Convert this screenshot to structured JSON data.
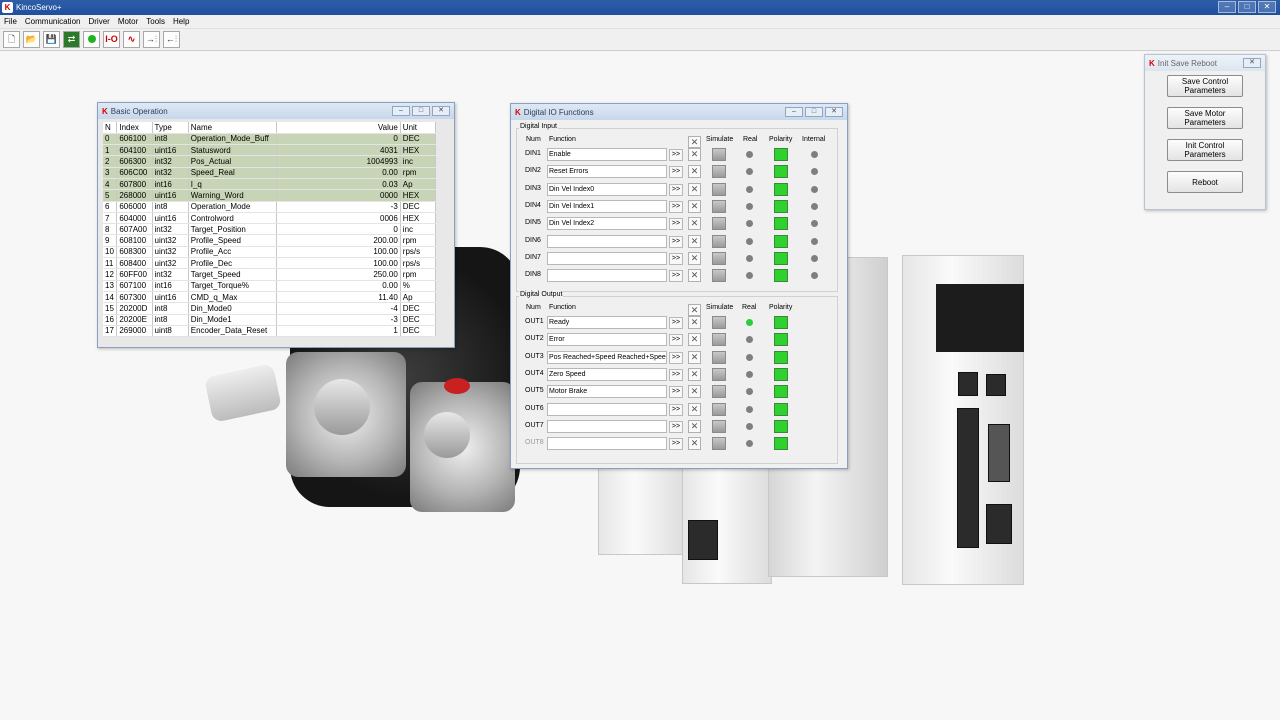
{
  "app": {
    "title": "KincoServo+",
    "logo": "K"
  },
  "menu": [
    "File",
    "Communication",
    "Driver",
    "Motor",
    "Tools",
    "Help"
  ],
  "toolbar": {
    "buttons": [
      {
        "name": "new-icon",
        "glyph": "🗋"
      },
      {
        "name": "open-folder-icon",
        "glyph": "📂"
      },
      {
        "name": "save-icon",
        "glyph": "💾"
      },
      {
        "name": "connect-icon",
        "glyph": "⇄"
      },
      {
        "name": "status-green-icon",
        "glyph": ""
      },
      {
        "name": "io-icon",
        "glyph": "I-O"
      },
      {
        "name": "scope-icon",
        "glyph": "∿"
      },
      {
        "name": "download-icon",
        "glyph": "→⫶"
      },
      {
        "name": "upload-icon",
        "glyph": "←⫶"
      }
    ]
  },
  "basic_operation": {
    "title": "Basic Operation",
    "columns": [
      "N",
      "Index",
      "Type",
      "Name",
      "Value",
      "Unit"
    ],
    "rows": [
      [
        "0",
        "606100",
        "int8",
        "Operation_Mode_Buff",
        "0",
        "DEC"
      ],
      [
        "1",
        "604100",
        "uint16",
        "Statusword",
        "4031",
        "HEX"
      ],
      [
        "2",
        "606300",
        "int32",
        "Pos_Actual",
        "1004993",
        "inc"
      ],
      [
        "3",
        "606C00",
        "int32",
        "Speed_Real",
        "0.00",
        "rpm"
      ],
      [
        "4",
        "607800",
        "int16",
        "I_q",
        "0.03",
        "Ap"
      ],
      [
        "5",
        "268000",
        "uint16",
        "Warning_Word",
        "0000",
        "HEX"
      ],
      [
        "6",
        "606000",
        "int8",
        "Operation_Mode",
        "-3",
        "DEC"
      ],
      [
        "7",
        "604000",
        "uint16",
        "Controlword",
        "0006",
        "HEX"
      ],
      [
        "8",
        "607A00",
        "int32",
        "Target_Position",
        "0",
        "inc"
      ],
      [
        "9",
        "608100",
        "uint32",
        "Profile_Speed",
        "200.00",
        "rpm"
      ],
      [
        "10",
        "608300",
        "uint32",
        "Profile_Acc",
        "100.00",
        "rps/s"
      ],
      [
        "11",
        "608400",
        "uint32",
        "Profile_Dec",
        "100.00",
        "rps/s"
      ],
      [
        "12",
        "60FF00",
        "int32",
        "Target_Speed",
        "250.00",
        "rpm"
      ],
      [
        "13",
        "607100",
        "int16",
        "Target_Torque%",
        "0.00",
        "%"
      ],
      [
        "14",
        "607300",
        "uint16",
        "CMD_q_Max",
        "11.40",
        "Ap"
      ],
      [
        "15",
        "20200D",
        "int8",
        "Din_Mode0",
        "-4",
        "DEC"
      ],
      [
        "16",
        "20200E",
        "int8",
        "Din_Mode1",
        "-3",
        "DEC"
      ],
      [
        "17",
        "269000",
        "uint8",
        "Encoder_Data_Reset",
        "1",
        "DEC"
      ]
    ],
    "highlighted_rows": 6
  },
  "digital_io": {
    "title": "Digital IO Functions",
    "input_group": "Digital Input",
    "output_group": "Digital Output",
    "headers": {
      "num": "Num",
      "function": "Function",
      "simulate": "Simulate",
      "real": "Real",
      "polarity": "Polarity",
      "internal": "Internal"
    },
    "inputs": [
      {
        "num": "DIN1",
        "function": "Enable"
      },
      {
        "num": "DIN2",
        "function": "Reset Errors"
      },
      {
        "num": "DIN3",
        "function": "Din Vel Index0"
      },
      {
        "num": "DIN4",
        "function": "Din Vel Index1"
      },
      {
        "num": "DIN5",
        "function": "Din Vel Index2"
      },
      {
        "num": "DIN6",
        "function": ""
      },
      {
        "num": "DIN7",
        "function": ""
      },
      {
        "num": "DIN8",
        "function": ""
      }
    ],
    "outputs": [
      {
        "num": "OUT1",
        "function": "Ready",
        "real_on": true
      },
      {
        "num": "OUT2",
        "function": "Error",
        "real_on": false
      },
      {
        "num": "OUT3",
        "function": "Pos Reached+Speed Reached+Speed",
        "real_on": false
      },
      {
        "num": "OUT4",
        "function": "Zero Speed",
        "real_on": false
      },
      {
        "num": "OUT5",
        "function": "Motor Brake",
        "real_on": false
      },
      {
        "num": "OUT6",
        "function": "",
        "real_on": false
      },
      {
        "num": "OUT7",
        "function": "",
        "real_on": false
      },
      {
        "num": "OUT8",
        "function": "",
        "real_on": false
      }
    ],
    "more_label": ">>",
    "clear_label": "✕"
  },
  "init_save_reboot": {
    "title": "Init Save Reboot",
    "buttons": [
      "Save Control Parameters",
      "Save Motor Parameters",
      "Init Control Parameters",
      "Reboot"
    ]
  },
  "colors": {
    "accent": "#2f5ea8",
    "highlight_row": "#c7d4b6",
    "polarity_green": "#2fd12f",
    "led_on": "#2ecc40",
    "led_off": "#7f7f7f"
  }
}
